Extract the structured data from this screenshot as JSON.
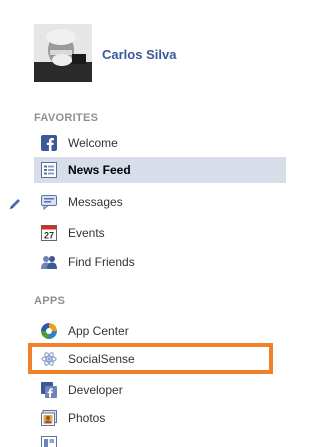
{
  "profile": {
    "name": "Carlos Silva"
  },
  "sections": {
    "favorites_header": "FAVORITES",
    "apps_header": "APPS"
  },
  "favorites": [
    {
      "label": "Welcome",
      "icon": "facebook-icon"
    },
    {
      "label": "News Feed",
      "icon": "news-feed-icon",
      "selected": true
    },
    {
      "label": "Messages",
      "icon": "messages-icon"
    },
    {
      "label": "Events",
      "icon": "calendar-icon"
    },
    {
      "label": "Find Friends",
      "icon": "friends-icon"
    }
  ],
  "apps": [
    {
      "label": "App Center",
      "icon": "app-center-icon"
    },
    {
      "label": "SocialSense",
      "icon": "atom-icon",
      "highlighted": true
    },
    {
      "label": "Developer",
      "icon": "developer-icon"
    },
    {
      "label": "Photos",
      "icon": "photos-icon"
    }
  ],
  "events_icon_day": "27",
  "colors": {
    "brand": "#3b5998",
    "selected_row": "#d7dde9",
    "highlight": "#f0812a",
    "section_header": "#8f8f8f"
  }
}
